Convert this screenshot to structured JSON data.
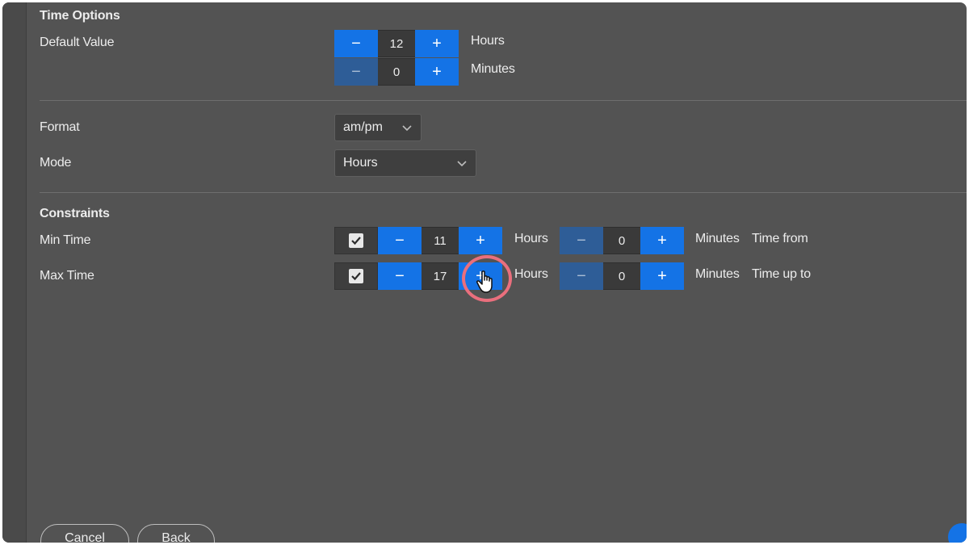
{
  "time_options": {
    "heading": "Time Options",
    "default_value_label": "Default Value",
    "default_hours": {
      "value": "12",
      "unit": "Hours"
    },
    "default_minutes": {
      "value": "0",
      "unit": "Minutes"
    }
  },
  "format": {
    "label": "Format",
    "selected": "am/pm"
  },
  "mode": {
    "label": "Mode",
    "selected": "Hours"
  },
  "constraints": {
    "heading": "Constraints",
    "min_time": {
      "label": "Min Time",
      "checked": true,
      "hours": "11",
      "hours_unit": "Hours",
      "minutes": "0",
      "minutes_unit": "Minutes",
      "suffix": "Time from"
    },
    "max_time": {
      "label": "Max Time",
      "checked": true,
      "hours": "17",
      "hours_unit": "Hours",
      "minutes": "0",
      "minutes_unit": "Minutes",
      "suffix": "Time up to"
    }
  },
  "controls": {
    "minus": "−",
    "plus": "+"
  },
  "footer": {
    "cancel": "Cancel",
    "back": "Back"
  },
  "icons": {
    "check": "check-icon",
    "chevron": "chevron-down-icon",
    "cursor": "hand-pointer-icon"
  },
  "colors": {
    "accent": "#1473e6",
    "panel": "#535353",
    "highlight_ring": "#ea6f7d"
  }
}
